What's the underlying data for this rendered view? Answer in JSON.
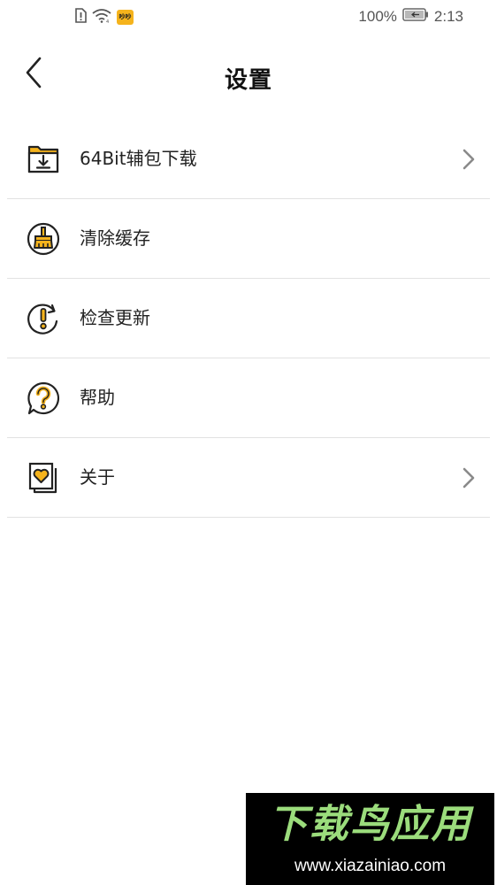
{
  "status_bar": {
    "app_badge": "吵吵",
    "battery_percent": "100%",
    "time": "2:13"
  },
  "header": {
    "title": "设置"
  },
  "settings": {
    "items": [
      {
        "label": "64Bit辅包下载",
        "icon": "download-folder-icon",
        "has_chevron": true
      },
      {
        "label": "清除缓存",
        "icon": "broom-icon",
        "has_chevron": false
      },
      {
        "label": "检查更新",
        "icon": "update-alert-icon",
        "has_chevron": false
      },
      {
        "label": "帮助",
        "icon": "help-question-icon",
        "has_chevron": false
      },
      {
        "label": "关于",
        "icon": "about-heart-icon",
        "has_chevron": true
      }
    ]
  },
  "watermark": {
    "title": "下载鸟应用",
    "url": "www.xiazainiao.com"
  },
  "colors": {
    "accent_yellow": "#f5b31c",
    "icon_stroke": "#222222",
    "divider": "#e2e2e2",
    "chevron": "#8a8a8a",
    "watermark_green": "#9bdc7c"
  }
}
